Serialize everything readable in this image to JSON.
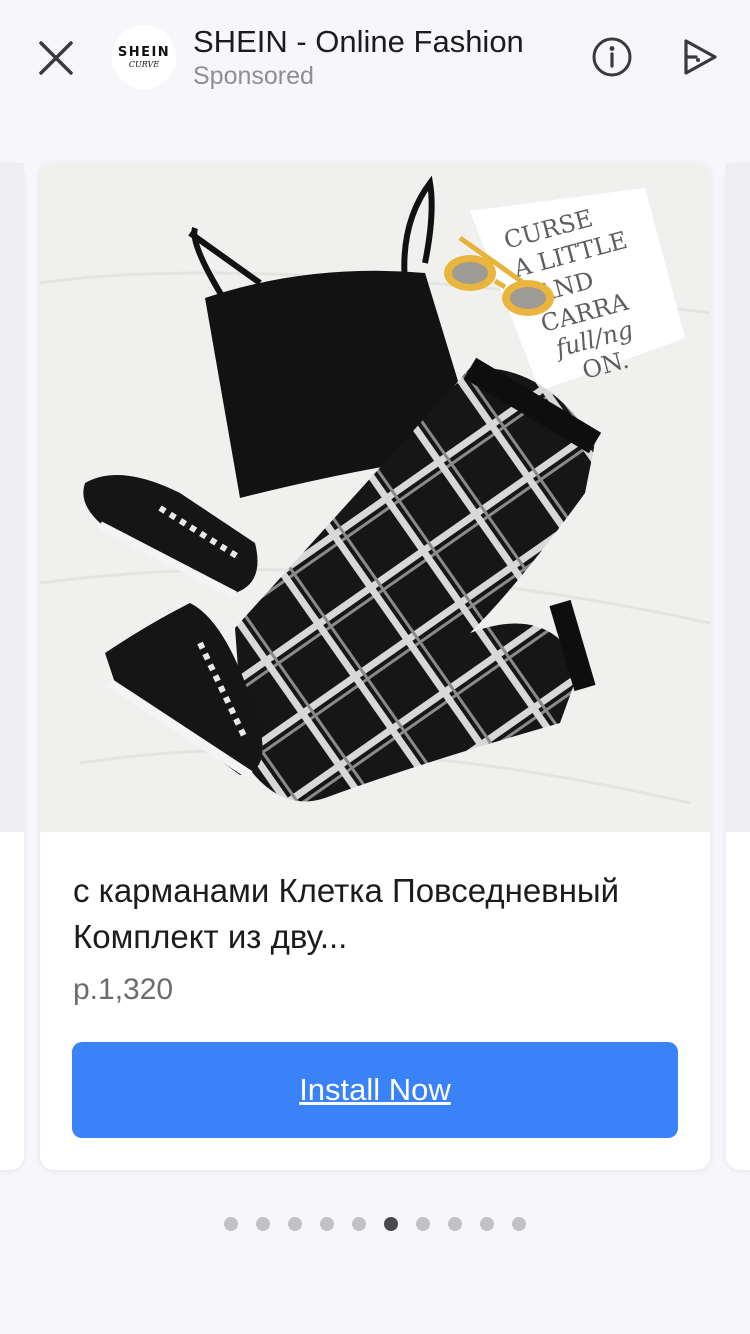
{
  "header": {
    "avatar": {
      "brand": "SHEIN",
      "sub": "CURVE"
    },
    "title": "SHEIN - Online Fashion",
    "subtitle": "Sponsored",
    "icons": [
      "close-icon",
      "info-icon",
      "share-icon"
    ]
  },
  "card": {
    "photo_text": [
      "CURSE",
      "A LITTLE",
      "AND",
      "CARRA",
      "full/ng",
      "ON."
    ],
    "product_title": "с карманами Клетка Повседневный Комплект из дву...",
    "price": "р.1,320",
    "cta_label": "Install Now",
    "cta_color": "#3a82f7"
  },
  "pagination": {
    "total": 10,
    "active_index": 5
  }
}
